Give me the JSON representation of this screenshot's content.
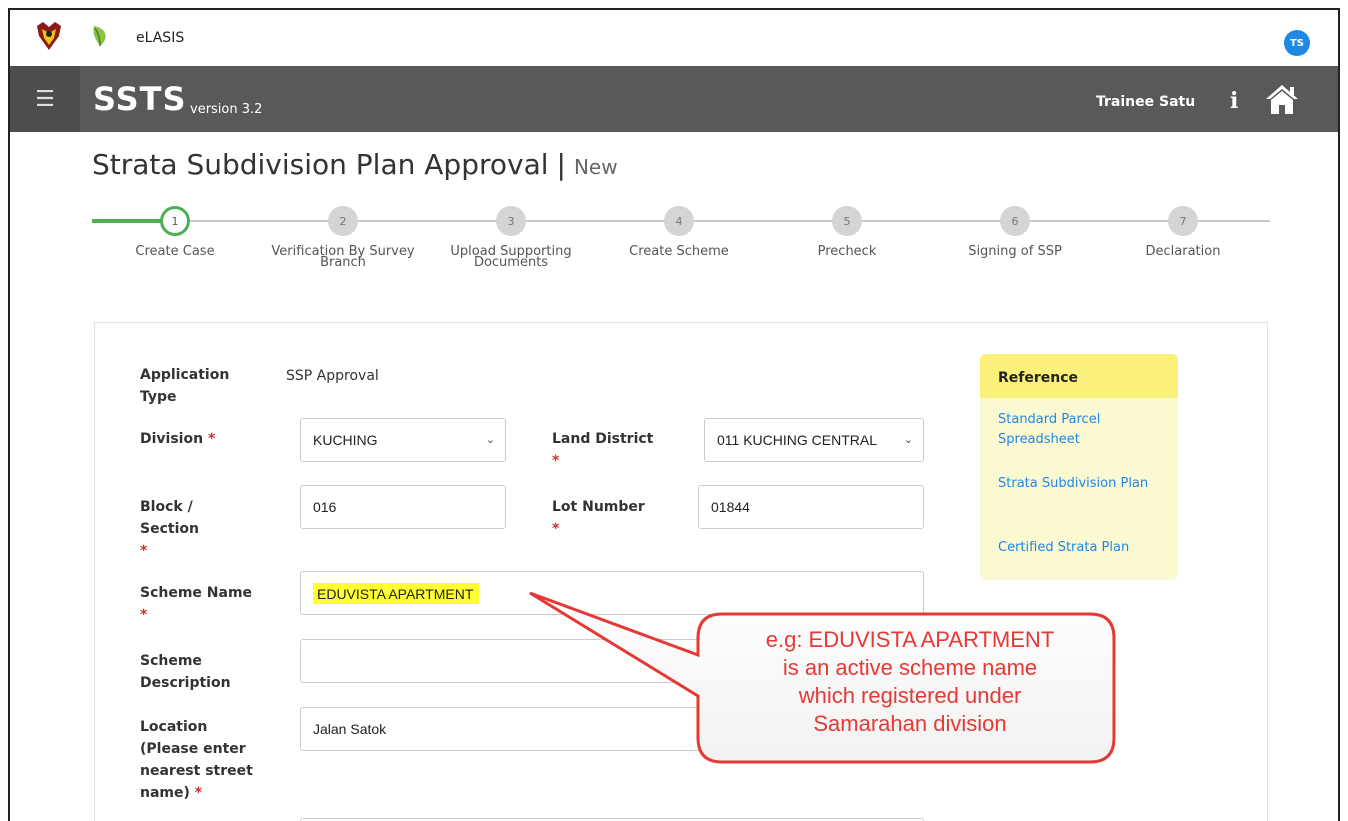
{
  "topbar": {
    "app_name": "eLASIS",
    "avatar_initials": "TS"
  },
  "header": {
    "brand": "SSTS",
    "version": "version 3.2",
    "user_name": "Trainee Satu",
    "info_icon": "i"
  },
  "page": {
    "title": "Strata Subdivision Plan Approval",
    "separator": "|",
    "status": "New"
  },
  "stepper": {
    "current_step": 1,
    "steps": [
      {
        "num": "1",
        "label": "Create Case"
      },
      {
        "num": "2",
        "label": "Verification By Survey Branch"
      },
      {
        "num": "3",
        "label": "Upload Supporting Documents"
      },
      {
        "num": "4",
        "label": "Create Scheme"
      },
      {
        "num": "5",
        "label": "Precheck"
      },
      {
        "num": "6",
        "label": "Signing of SSP"
      },
      {
        "num": "7",
        "label": "Declaration"
      }
    ]
  },
  "form": {
    "application_type_label": "Application Type",
    "application_type_value": "SSP Approval",
    "division_label": "Division",
    "division_value": "KUCHING",
    "land_district_label": "Land District",
    "land_district_value": "011 KUCHING CENTRAL",
    "block_label": "Block / Section",
    "block_value": "016",
    "lot_label": "Lot Number",
    "lot_value": "01844",
    "scheme_name_label": "Scheme Name",
    "scheme_name_value": "EDUVISTA APARTMENT",
    "scheme_desc_label": "Scheme Description",
    "scheme_desc_value": "",
    "location_label": "Location (Please enter nearest street name)",
    "location_value": "Jalan Satok",
    "required_mark": "*"
  },
  "reference": {
    "title": "Reference",
    "links": [
      "Standard Parcel Spreadsheet",
      "Strata Subdivision Plan",
      "Certified Strata Plan"
    ]
  },
  "callout": {
    "lines": [
      "e.g: EDUVISTA APARTMENT",
      "is an active scheme name",
      "which registered under",
      "Samarahan division"
    ]
  },
  "colors": {
    "accent_green": "#4caf50",
    "header_dark": "#595959",
    "link_blue": "#1e88e5",
    "callout_red": "#e53935",
    "highlight_yellow": "#ffff33"
  }
}
